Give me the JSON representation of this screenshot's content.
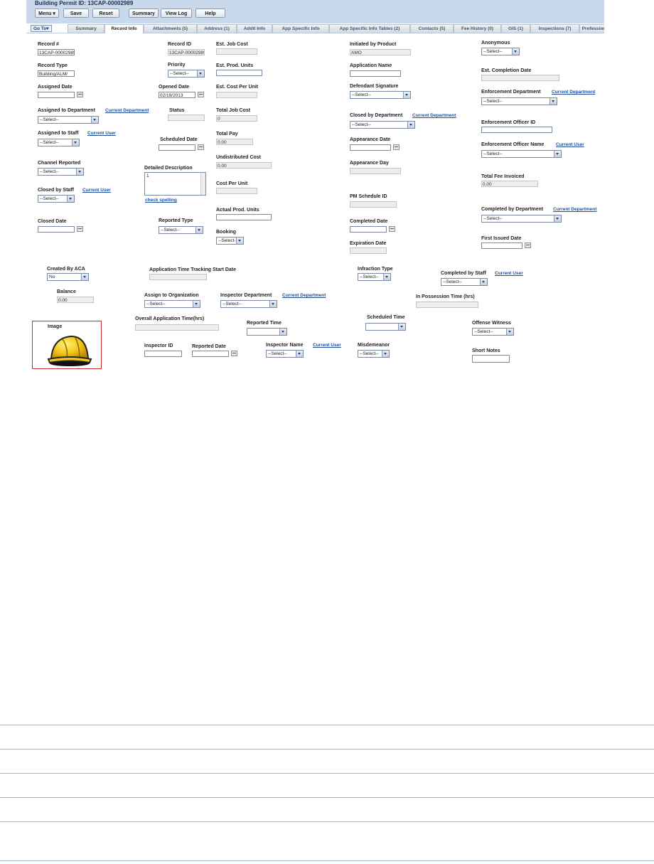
{
  "header": {
    "title": "Building Permit ID: 13CAP-00002989",
    "buttons": [
      "Menu",
      "Save",
      "Reset",
      "Summary",
      "View Log",
      "Help"
    ]
  },
  "tabs": {
    "goto": "Go To",
    "items": [
      "Summary",
      "Record Info",
      "Attachments (5)",
      "Address (1)",
      "Addtl Info",
      "App Specific Info",
      "App Specific Info Tables (2)",
      "Contacts (5)",
      "Fee History (0)",
      "GIS (1)",
      "Inspections (7)",
      "Professionals"
    ],
    "active": "Record Info"
  },
  "form": {
    "record_no": {
      "label": "Record #",
      "value": "13CAP-00002989"
    },
    "record_id": {
      "label": "Record ID",
      "value": "13CAP-00002989"
    },
    "est_job_cost": {
      "label": "Est. Job Cost",
      "value": ""
    },
    "initiated_by_product": {
      "label": "Initiated by Product",
      "value": "AMO"
    },
    "anonymous": {
      "label": "Anonymous",
      "value": "--Select--"
    },
    "record_type": {
      "label": "Record Type",
      "value": "Building/ALM/"
    },
    "priority": {
      "label": "Priority",
      "value": "--Select--"
    },
    "est_prod_units": {
      "label": "Est. Prod. Units",
      "value": ""
    },
    "application_name": {
      "label": "Application Name",
      "value": ""
    },
    "est_completion_date": {
      "label": "Est. Completion Date",
      "value": ""
    },
    "assigned_date": {
      "label": "Assigned Date",
      "value": ""
    },
    "opened_date": {
      "label": "Opened Date",
      "value": "02/19/2013"
    },
    "est_cost_per_unit": {
      "label": "Est. Cost Per Unit",
      "value": ""
    },
    "defendant_signature": {
      "label": "Defendant Signature",
      "value": "--Select--"
    },
    "enforcement_department": {
      "label": "Enforcement Department",
      "link": "Current Department",
      "value": "--Select--"
    },
    "assigned_to_department": {
      "label": "Assigned to Department",
      "link": "Current Department",
      "value": "--Select--"
    },
    "status": {
      "label": "Status",
      "value": ""
    },
    "total_job_cost": {
      "label": "Total Job Cost",
      "value": "0"
    },
    "closed_by_department": {
      "label": "Closed by Department",
      "link": "Current Department",
      "value": "--Select--"
    },
    "enforcement_officer_id": {
      "label": "Enforcement Officer ID",
      "value": ""
    },
    "assigned_to_staff": {
      "label": "Assigned to Staff",
      "link": "Current User",
      "value": "--Select--"
    },
    "scheduled_date": {
      "label": "Scheduled Date",
      "value": ""
    },
    "total_pay": {
      "label": "Total Pay",
      "value": "0.00"
    },
    "appearance_date": {
      "label": "Appearance Date",
      "value": ""
    },
    "enforcement_officer_name": {
      "label": "Enforcement Officer Name",
      "link": "Current User",
      "value": "--Select--"
    },
    "channel_reported": {
      "label": "Channel Reported",
      "value": "--Select--"
    },
    "detailed_description": {
      "label": "Detailed Description",
      "value": "1"
    },
    "undistributed_cost": {
      "label": "Undistributed Cost",
      "value": "0.00"
    },
    "appearance_day": {
      "label": "Appearance Day",
      "value": ""
    },
    "total_fee_invoiced": {
      "label": "Total Fee Invoiced",
      "value": "0.00"
    },
    "check_spelling": "check spelling",
    "cost_per_unit": {
      "label": "Cost Per Unit",
      "value": ""
    },
    "closed_by_staff": {
      "label": "Closed by Staff",
      "link": "Current User",
      "value": "--Select--"
    },
    "pm_schedule_id": {
      "label": "PM Schedule ID",
      "value": ""
    },
    "actual_prod_units": {
      "label": "Actual Prod. Units",
      "value": ""
    },
    "completed_by_department": {
      "label": "Completed by Department",
      "link": "Current Department",
      "value": "--Select--"
    },
    "closed_date": {
      "label": "Closed Date",
      "value": ""
    },
    "reported_type": {
      "label": "Reported Type",
      "value": "--Select--"
    },
    "completed_date": {
      "label": "Completed Date",
      "value": ""
    },
    "booking": {
      "label": "Booking",
      "value": "--Select--"
    },
    "first_issued_date": {
      "label": "First Issued Date",
      "value": ""
    },
    "expiration_date": {
      "label": "Expiration Date",
      "value": ""
    },
    "created_by_aca": {
      "label": "Created By ACA",
      "value": "No"
    },
    "application_time_tracking_start_date": {
      "label": "Application Time Tracking Start Date",
      "value": ""
    },
    "infraction_type": {
      "label": "Infraction Type",
      "value": "--Select--"
    },
    "completed_by_staff": {
      "label": "Completed by Staff",
      "link": "Current User",
      "value": "--Select--"
    },
    "balance": {
      "label": "Balance",
      "value": "0.00"
    },
    "assign_to_organization": {
      "label": "Assign to Organization",
      "value": "--Select--"
    },
    "inspector_department": {
      "label": "Inspector Department",
      "link": "Current Department",
      "value": "--Select--"
    },
    "in_possession_time": {
      "label": "In Possession Time (hrs)",
      "value": ""
    },
    "image": {
      "label": "Image",
      "icon": "hard-hat-icon"
    },
    "overall_application_time": {
      "label": "Overall Application Time(hrs)",
      "value": ""
    },
    "reported_time": {
      "label": "Reported Time",
      "value": ""
    },
    "scheduled_time": {
      "label": "Scheduled Time",
      "value": ""
    },
    "offense_witness": {
      "label": "Offense Witness",
      "value": "--Select--"
    },
    "inspector_id": {
      "label": "Inspector ID",
      "value": ""
    },
    "reported_date": {
      "label": "Reported Date",
      "value": ""
    },
    "inspector_name": {
      "label": "Inspector Name",
      "link": "Current User",
      "value": "--Select--"
    },
    "misdemeanor": {
      "label": "Misdemeanor",
      "value": "--Select--"
    },
    "short_notes": {
      "label": "Short Notes",
      "value": ""
    }
  },
  "colors": {
    "header_bg": "#c9d9ec",
    "link": "#1f4e9a",
    "image_border": "#c92b2b",
    "rule_lines": "#9bb5cf",
    "hat_yellow": "#f5c518"
  }
}
